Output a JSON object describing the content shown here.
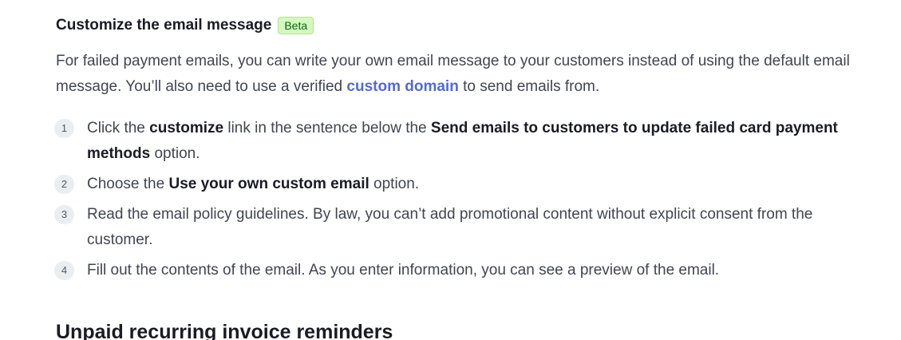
{
  "section": {
    "title": "Customize the email message",
    "badge": "Beta"
  },
  "intro": {
    "text_1": "For failed payment emails, you can write your own email message to your customers instead of using the default email message. You’ll also need to use a verified ",
    "link": "custom domain",
    "text_2": " to send emails from."
  },
  "steps": [
    {
      "number": "1",
      "t1": "Click the ",
      "b1": "customize",
      "t2": " link in the sentence below the ",
      "b2": "Send emails to customers to update failed card payment methods",
      "t3": " option."
    },
    {
      "number": "2",
      "t1": "Choose the ",
      "b1": "Use your own custom email",
      "t2": " option."
    },
    {
      "number": "3",
      "t1": "Read the email policy guidelines. By law, you can’t add promotional content without explicit consent from the customer."
    },
    {
      "number": "4",
      "t1": "Fill out the contents of the email. As you enter information, you can see a preview of the email."
    }
  ],
  "next_section": {
    "title": "Unpaid recurring invoice reminders"
  }
}
